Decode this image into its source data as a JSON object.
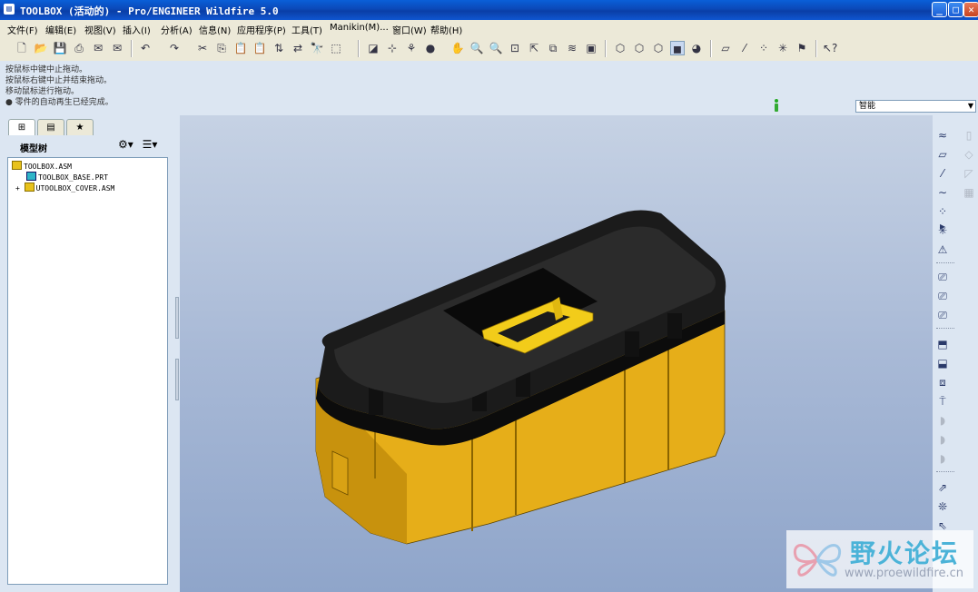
{
  "window": {
    "title": "TOOLBOX (活动的) - Pro/ENGINEER Wildfire 5.0",
    "app_icon": "proe-icon",
    "controls": [
      "minimize",
      "maximize",
      "close"
    ]
  },
  "menu": [
    "文件(F)",
    "编辑(E)",
    "视图(V)",
    "插入(I)",
    "分析(A)",
    "信息(N)",
    "应用程序(P)",
    "工具(T)",
    "Manikin(M)...",
    "窗口(W)",
    "帮助(H)"
  ],
  "message_area": {
    "lines": [
      "按鼠标中键中止拖动。",
      "按鼠标右键中止并结束拖动。",
      "移动鼠标进行拖动。",
      "● 零件的自动再生已经完成。"
    ]
  },
  "filter": {
    "value": "智能"
  },
  "left_panel": {
    "tabs": [
      "model-tree-tab",
      "folder-browser-tab",
      "favorites-tab"
    ],
    "tree_title": "模型树",
    "tree": [
      {
        "label": "TOOLBOX.ASM",
        "type": "asm",
        "expander": ""
      },
      {
        "label": "TOOLBOX_BASE.PRT",
        "type": "prt",
        "expander": ""
      },
      {
        "label": "UTOOLBOX_COVER.ASM",
        "type": "asm",
        "expander": "+"
      }
    ]
  },
  "watermark": {
    "text": "野火论坛",
    "url": "www.proewildfire.cn"
  },
  "colors": {
    "title_bar": "#0a4cbc",
    "box_body": "#e8b01c",
    "box_lid": "#1e1e1e",
    "handle": "#f2cc1a",
    "background_top": "#c6d2e4",
    "background_bottom": "#8fa5ca"
  }
}
